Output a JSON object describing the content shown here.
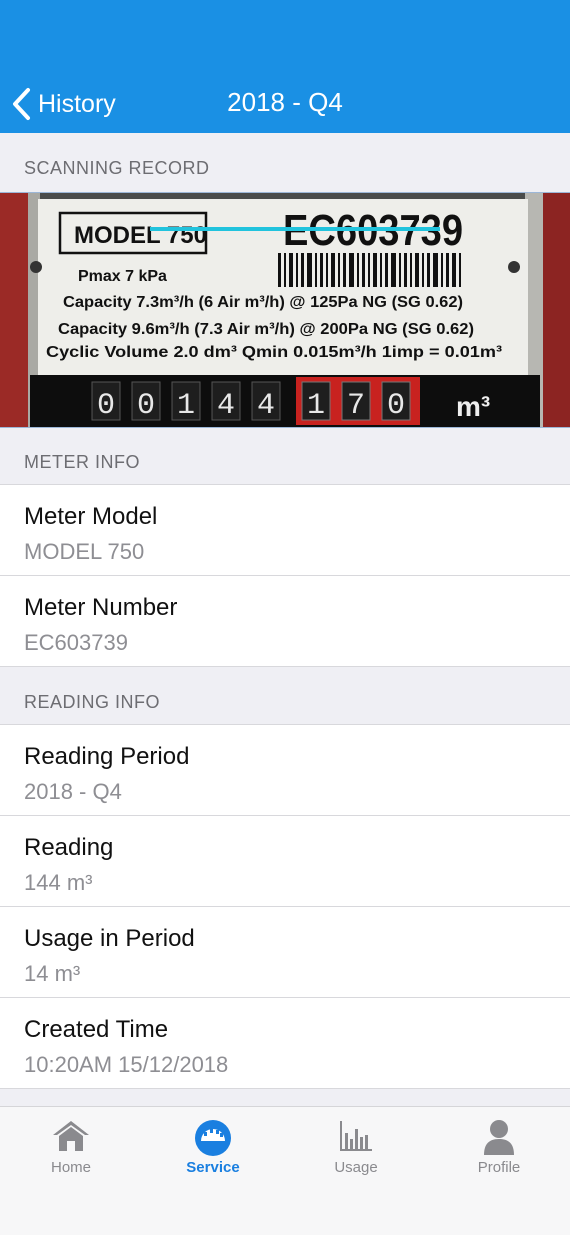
{
  "nav": {
    "back_label": "History",
    "title": "2018 - Q4"
  },
  "sections": {
    "scanning": "SCANNING RECORD",
    "meter": "METER INFO",
    "reading": "READING INFO"
  },
  "photo": {
    "model_plate": "MODEL 750",
    "serial": "EC603739",
    "pmax": "Pmax 7 kPa",
    "cap1": "Capacity 7.3m³/h (6 Air m³/h) @ 125Pa NG (SG 0.62)",
    "cap2": "Capacity 9.6m³/h (7.3 Air m³/h) @ 200Pa NG (SG 0.62)",
    "cyclic": "Cyclic Volume 2.0 dm³  Qmin 0.015m³/h   1imp = 0.01m³",
    "digits_black": [
      "0",
      "0",
      "1",
      "4",
      "4"
    ],
    "digits_red": [
      "1",
      "7",
      "0"
    ],
    "unit": "m³"
  },
  "meter_info": [
    {
      "label": "Meter Model",
      "value": "MODEL 750"
    },
    {
      "label": "Meter Number",
      "value": "EC603739"
    }
  ],
  "reading_info": [
    {
      "label": "Reading Period",
      "value": "2018 - Q4"
    },
    {
      "label": "Reading",
      "value": "144 m³"
    },
    {
      "label": "Usage in Period",
      "value": "14 m³"
    },
    {
      "label": "Created Time",
      "value": "10:20AM 15/12/2018"
    }
  ],
  "tabs": [
    {
      "label": "Home",
      "icon": "home-icon",
      "active": false
    },
    {
      "label": "Service",
      "icon": "gauge-icon",
      "active": true
    },
    {
      "label": "Usage",
      "icon": "bar-chart-icon",
      "active": false
    },
    {
      "label": "Profile",
      "icon": "person-icon",
      "active": false
    }
  ],
  "colors": {
    "header": "#1a90e4",
    "active_tab": "#1a7fe0",
    "inactive_tab": "#8a8a8e"
  }
}
